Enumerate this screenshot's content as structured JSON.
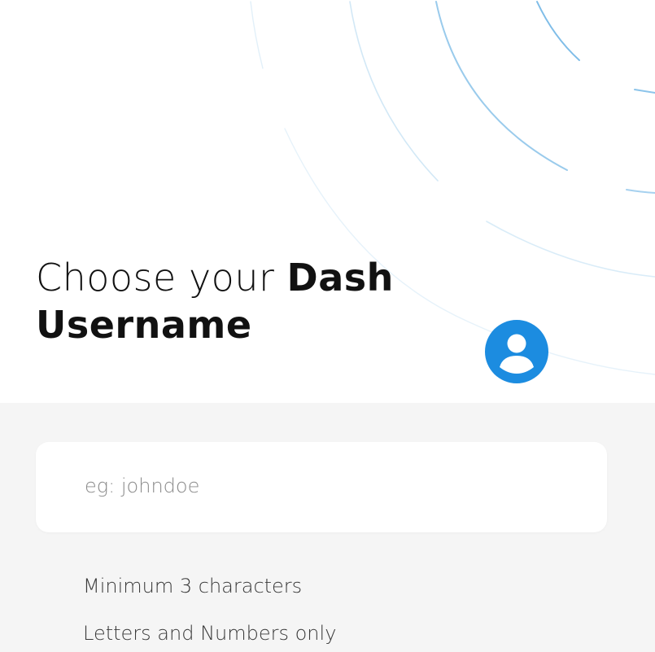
{
  "screen": {
    "title_light": "Choose your ",
    "title_bold_1": "Dash",
    "title_bold_2": "Username"
  },
  "username_field": {
    "placeholder": "eg: johndoe",
    "value": ""
  },
  "requirements": [
    "Minimum 3 characters",
    "Letters and Numbers only"
  ],
  "icons": {
    "avatar": "user-circle-icon"
  },
  "colors": {
    "accent": "#1c8ce0",
    "arc_lines": "#8cc4ea",
    "form_background": "#f5f5f5",
    "card_background": "#ffffff",
    "title_text": "#111111"
  }
}
